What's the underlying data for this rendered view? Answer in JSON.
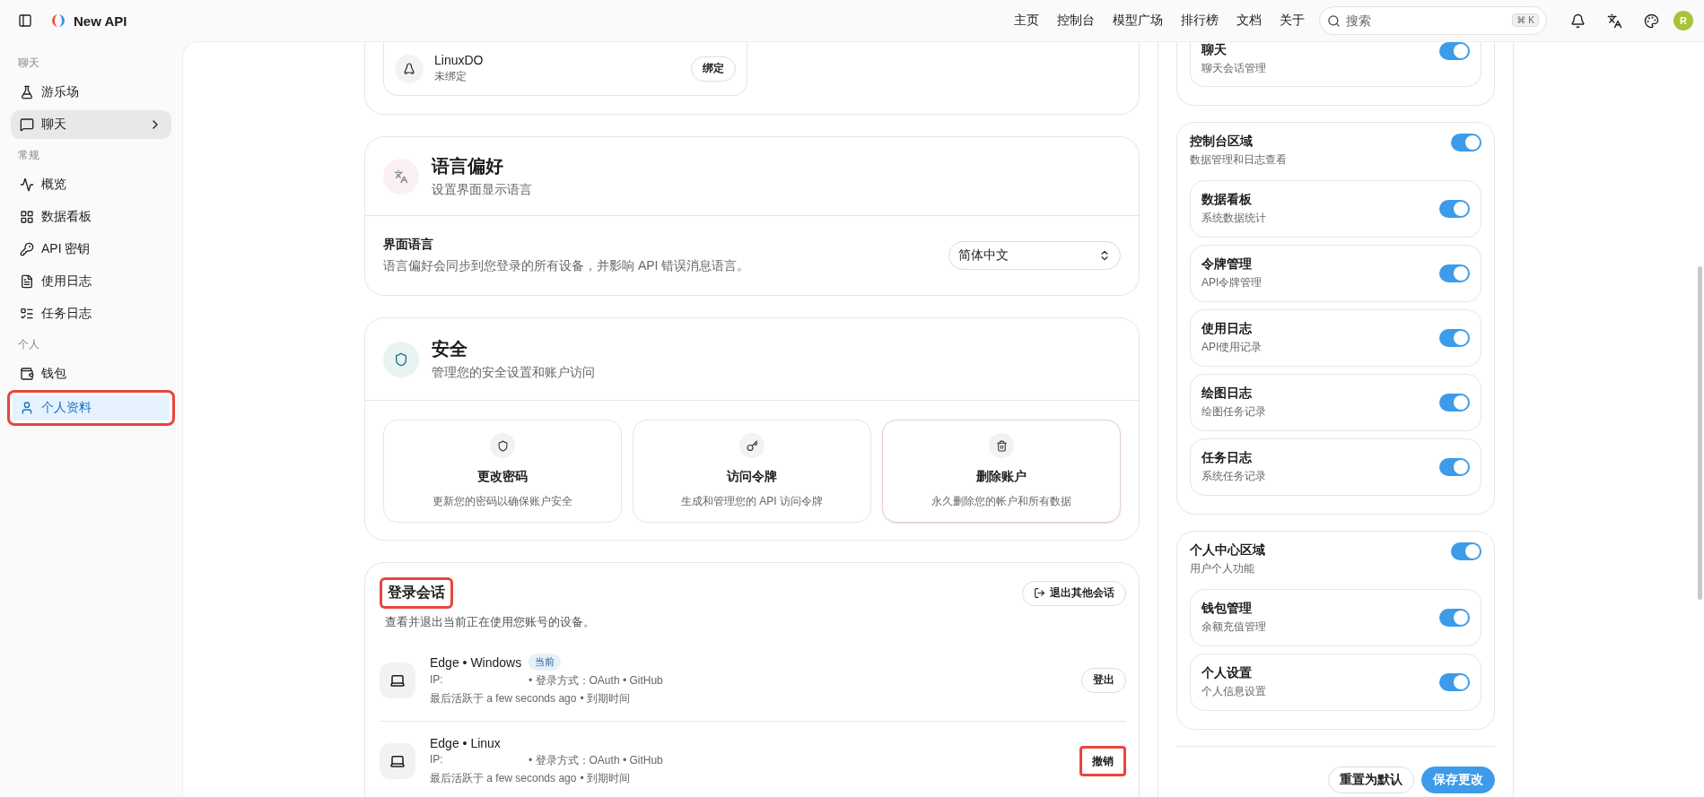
{
  "topbar": {
    "app_name": "New API",
    "nav": [
      {
        "label": "主页"
      },
      {
        "label": "控制台"
      },
      {
        "label": "模型广场"
      },
      {
        "label": "排行榜"
      },
      {
        "label": "文档"
      },
      {
        "label": "关于"
      }
    ],
    "search": {
      "placeholder": "搜索",
      "shortcut": [
        "⌘",
        "K"
      ]
    },
    "avatar": "R"
  },
  "sidebar": {
    "sections": [
      {
        "heading": "聊天",
        "items": [
          {
            "label": "游乐场",
            "selected": false,
            "hovered": false,
            "expandable": false,
            "annotated": false
          },
          {
            "label": "聊天",
            "selected": false,
            "hovered": true,
            "expandable": true,
            "annotated": false
          }
        ]
      },
      {
        "heading": "常规",
        "items": [
          {
            "label": "概览",
            "selected": false,
            "hovered": false,
            "expandable": false,
            "annotated": false
          },
          {
            "label": "数据看板",
            "selected": false,
            "hovered": false,
            "expandable": false,
            "annotated": false
          },
          {
            "label": "API 密钥",
            "selected": false,
            "hovered": false,
            "expandable": false,
            "annotated": false
          },
          {
            "label": "使用日志",
            "selected": false,
            "hovered": false,
            "expandable": false,
            "annotated": false
          },
          {
            "label": "任务日志",
            "selected": false,
            "hovered": false,
            "expandable": false,
            "annotated": false
          }
        ]
      },
      {
        "heading": "个人",
        "items": [
          {
            "label": "钱包",
            "selected": false,
            "hovered": false,
            "expandable": false,
            "annotated": false
          },
          {
            "label": "个人资料",
            "selected": true,
            "hovered": false,
            "expandable": false,
            "annotated": true
          }
        ]
      }
    ]
  },
  "bindings": {
    "items": [
      {
        "name": "LinuxDO",
        "status": "未绑定",
        "action": "绑定"
      }
    ]
  },
  "language": {
    "title": "语言偏好",
    "subtitle": "设置界面显示语言",
    "setting": {
      "label": "界面语言",
      "description": "语言偏好会同步到您登录的所有设备，并影响 API 错误消息语言。",
      "value": "简体中文"
    }
  },
  "security": {
    "title": "安全",
    "subtitle": "管理您的安全设置和账户访问",
    "actions": [
      {
        "kind": "password",
        "title": "更改密码",
        "description": "更新您的密码以确保账户安全"
      },
      {
        "kind": "token",
        "title": "访问令牌",
        "description": "生成和管理您的 API 访问令牌"
      },
      {
        "kind": "delete",
        "title": "删除账户",
        "description": "永久删除您的帐户和所有数据"
      }
    ]
  },
  "sessions": {
    "title": "登录会话",
    "annotated": true,
    "description": "查看并退出当前正在使用您账号的设备。",
    "logout_others": "退出其他会话",
    "items": [
      {
        "device": "Edge • Windows",
        "badge": "当前",
        "ip_label": "IP:",
        "login_method": "• 登录方式：OAuth • GitHub",
        "last_active": "最后活跃于 a few seconds ago",
        "expires": "• 到期时间",
        "action": "登出",
        "annotated": false
      },
      {
        "device": "Edge • Linux",
        "ip_label": "IP:",
        "login_method": "• 登录方式：OAuth • GitHub",
        "last_active": "最后活跃于 a few seconds ago",
        "expires": "• 到期时间",
        "action": "撤销",
        "annotated": true
      }
    ]
  },
  "modules": {
    "groups": [
      {
        "items": [
          {
            "title": "聊天",
            "description": "聊天会话管理",
            "on": true
          }
        ]
      },
      {
        "title": "控制台区域",
        "description": "数据管理和日志查看",
        "on": true,
        "items": [
          {
            "title": "数据看板",
            "description": "系统数据统计",
            "on": true
          },
          {
            "title": "令牌管理",
            "description": "API令牌管理",
            "on": true
          },
          {
            "title": "使用日志",
            "description": "API使用记录",
            "on": true
          },
          {
            "title": "绘图日志",
            "description": "绘图任务记录",
            "on": true
          },
          {
            "title": "任务日志",
            "description": "系统任务记录",
            "on": true
          }
        ]
      },
      {
        "title": "个人中心区域",
        "description": "用户个人功能",
        "on": true,
        "items": [
          {
            "title": "钱包管理",
            "description": "余额充值管理",
            "on": true
          },
          {
            "title": "个人设置",
            "description": "个人信息设置",
            "on": true
          }
        ]
      }
    ],
    "reset": "重置为默认",
    "save": "保存更改"
  }
}
